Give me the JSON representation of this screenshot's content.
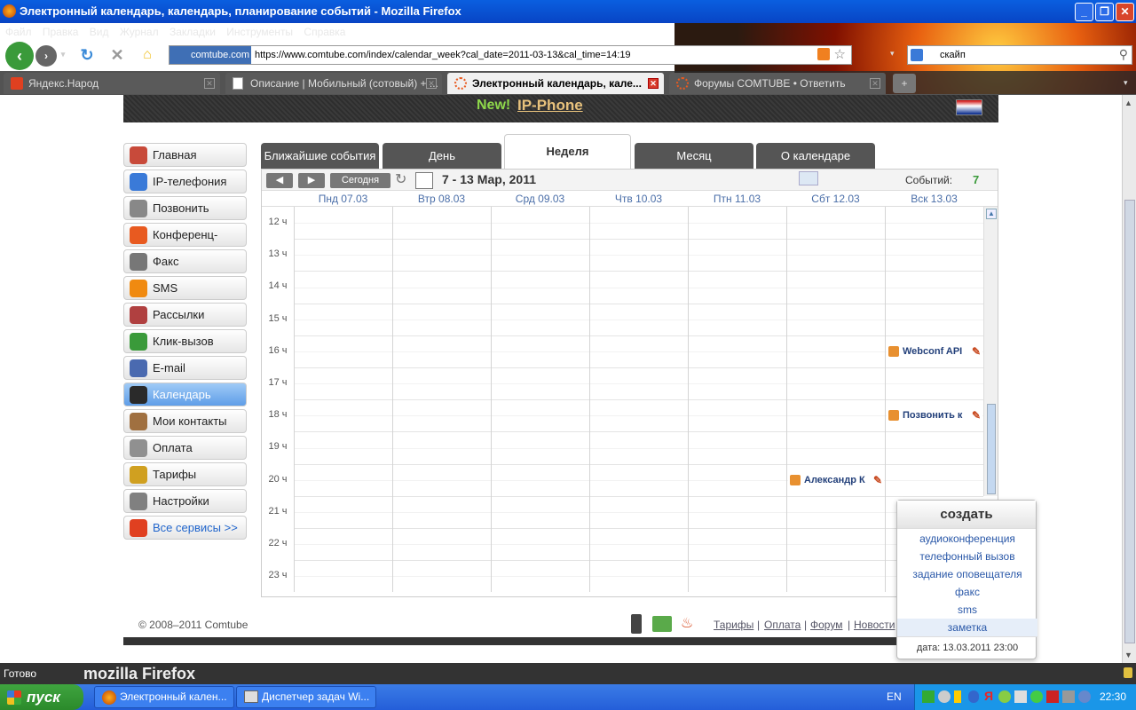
{
  "window": {
    "title": "Электронный календарь, календарь, планирование событий - Mozilla Firefox"
  },
  "menu": [
    "Файл",
    "Правка",
    "Вид",
    "Журнал",
    "Закладки",
    "Инструменты",
    "Справка"
  ],
  "address": {
    "site": "comtube.com",
    "url": "https://www.comtube.com/index/calendar_week?cal_date=2011-03-13&cal_time=14:19"
  },
  "search": {
    "value": "скайп"
  },
  "tabs": [
    {
      "label": "Яндекс.Народ"
    },
    {
      "label": "Описание | Мобильный (сотовый) + ..."
    },
    {
      "label": "Электронный календарь, кале..."
    },
    {
      "label": "Форумы COMTUBE • Ответить"
    }
  ],
  "banner": {
    "new": "New!",
    "product": "IP-Phone"
  },
  "sidebar": [
    {
      "label": "Главная",
      "color": "#c84a3a"
    },
    {
      "label": "IP-телефония",
      "color": "#3a7ad8"
    },
    {
      "label": "Позвонить",
      "color": "#888888"
    },
    {
      "label": "Конференц-связь",
      "color": "#e85a20"
    },
    {
      "label": "Факс",
      "color": "#777777"
    },
    {
      "label": "SMS",
      "color": "#f08a10"
    },
    {
      "label": "Рассылки",
      "color": "#b04040"
    },
    {
      "label": "Клик-вызов",
      "color": "#3a9a3a"
    },
    {
      "label": "E-mail",
      "color": "#4a6ab0"
    },
    {
      "label": "Календарь",
      "color": "#2a2a2a"
    },
    {
      "label": "Мои контакты",
      "color": "#a07040"
    },
    {
      "label": "Оплата",
      "color": "#909090"
    },
    {
      "label": "Тарифы",
      "color": "#d0a020"
    },
    {
      "label": "Настройки",
      "color": "#808080"
    },
    {
      "label": "Все сервисы >>",
      "color": "#e04020"
    }
  ],
  "content_tabs": [
    "Ближайшие события",
    "День",
    "Неделя",
    "Месяц",
    "О календаре"
  ],
  "calendar": {
    "today_btn": "Сегодня",
    "range": "7 - 13 Мар, 2011",
    "events_label": "Событий:",
    "events_count": "7",
    "days": [
      "Пнд 07.03",
      "Втр 08.03",
      "Срд 09.03",
      "Чтв 10.03",
      "Птн 11.03",
      "Сбт 12.03",
      "Вск 13.03"
    ],
    "hours": [
      "12 ч",
      "13 ч",
      "14 ч",
      "15 ч",
      "16 ч",
      "17 ч",
      "18 ч",
      "19 ч",
      "20 ч",
      "21 ч",
      "22 ч",
      "23 ч"
    ],
    "events": [
      {
        "title": "Webconf API",
        "day": "Вск 13.03",
        "hour": "16 ч"
      },
      {
        "title": "Позвонить к",
        "day": "Вск 13.03",
        "hour": "18 ч"
      },
      {
        "title": "Александр К",
        "day": "Сбт 12.03",
        "hour": "20 ч"
      }
    ]
  },
  "popup": {
    "title": "создать",
    "items": [
      "аудиоконференция",
      "телефонный вызов",
      "задание оповещателя",
      "факс",
      "sms",
      "заметка"
    ],
    "date": "дата: 13.03.2011 23:00"
  },
  "footer": {
    "copyright": "© 2008–2011 Comtube",
    "links": [
      "Тарифы",
      "Оплата",
      "Форум",
      "Новости"
    ]
  },
  "status": {
    "text": "Готово",
    "brand": "mozilla Firefox"
  },
  "taskbar": {
    "start": "пуск",
    "tasks": [
      "Электронный кален...",
      "Диспетчер задач Wi..."
    ],
    "lang": "EN",
    "time": "22:30"
  }
}
